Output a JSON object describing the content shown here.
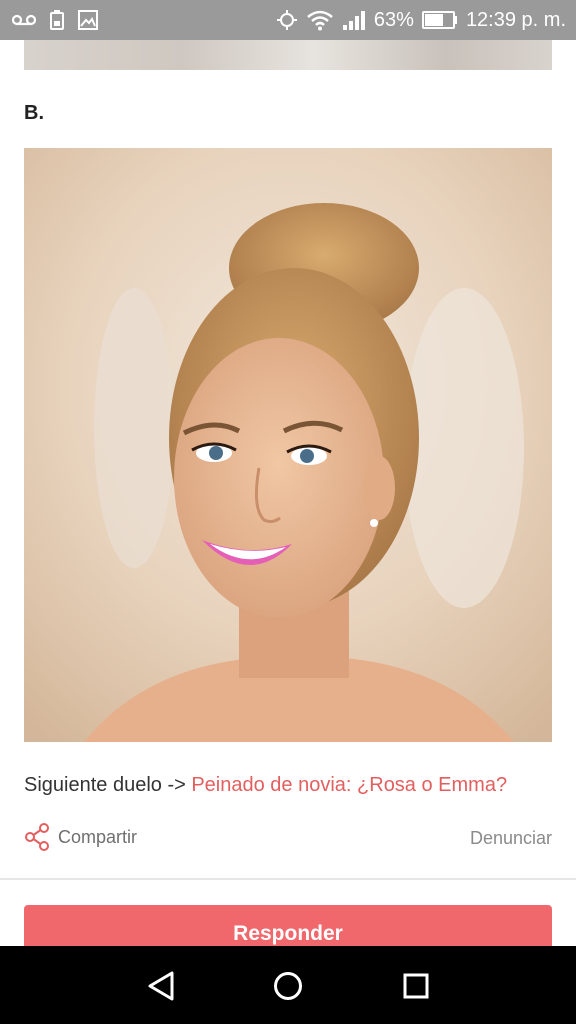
{
  "status_bar": {
    "battery_percent": "63%",
    "time": "12:39 p. m.",
    "icons": [
      "voicemail-icon",
      "battery-saver-icon",
      "image-icon",
      "wifi-icon",
      "signal-icon",
      "battery-icon"
    ]
  },
  "post": {
    "section_label": "B.",
    "photo_icon": "bride-portrait-image",
    "next_duel_prefix": "Siguiente duelo -> ",
    "next_duel_link": "Peinado de novia: ¿Rosa o Emma?"
  },
  "actions": {
    "share_label": "Compartir",
    "report_label": "Denunciar"
  },
  "respond": {
    "label": "Responder"
  },
  "nav": {
    "back_icon": "back-triangle-icon",
    "home_icon": "home-circle-icon",
    "recents_icon": "recents-square-icon"
  },
  "colors": {
    "status_bar": "#9a9a9a",
    "accent": "#e35f5f",
    "button": "#f0686c",
    "nav_bar": "#000000"
  }
}
